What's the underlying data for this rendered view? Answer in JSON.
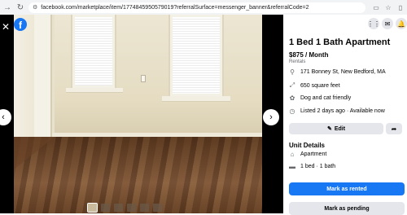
{
  "browser": {
    "url": "facebook.com/marketplace/item/1774845950579019?referralSurface=messenger_banner&referralCode=2",
    "back_icon": "arrow-right-icon",
    "reload_icon": "reload-icon"
  },
  "viewer": {
    "close_glyph": "✕",
    "logo_letter": "f",
    "prev_glyph": "‹",
    "next_glyph": "›",
    "thumbnail_count": 6
  },
  "listing": {
    "title": "1 Bed 1 Bath Apartment",
    "price": "$875 / Month",
    "category": "Rentals",
    "address": "171 Bonney St, New Bedford, MA",
    "size": "650 square feet",
    "pets": "Dog and cat friendly",
    "listed": "Listed 2 days ago · Available now"
  },
  "actions": {
    "edit_label": "Edit",
    "mark_rented_label": "Mark as rented",
    "mark_pending_label": "Mark as pending"
  },
  "unit_details": {
    "heading": "Unit Details",
    "type": "Apartment",
    "beds_baths": "1 bed · 1 bath"
  },
  "colors": {
    "accent": "#1877f2",
    "button_gray": "#e4e6eb",
    "secondary_text": "#65676b"
  }
}
